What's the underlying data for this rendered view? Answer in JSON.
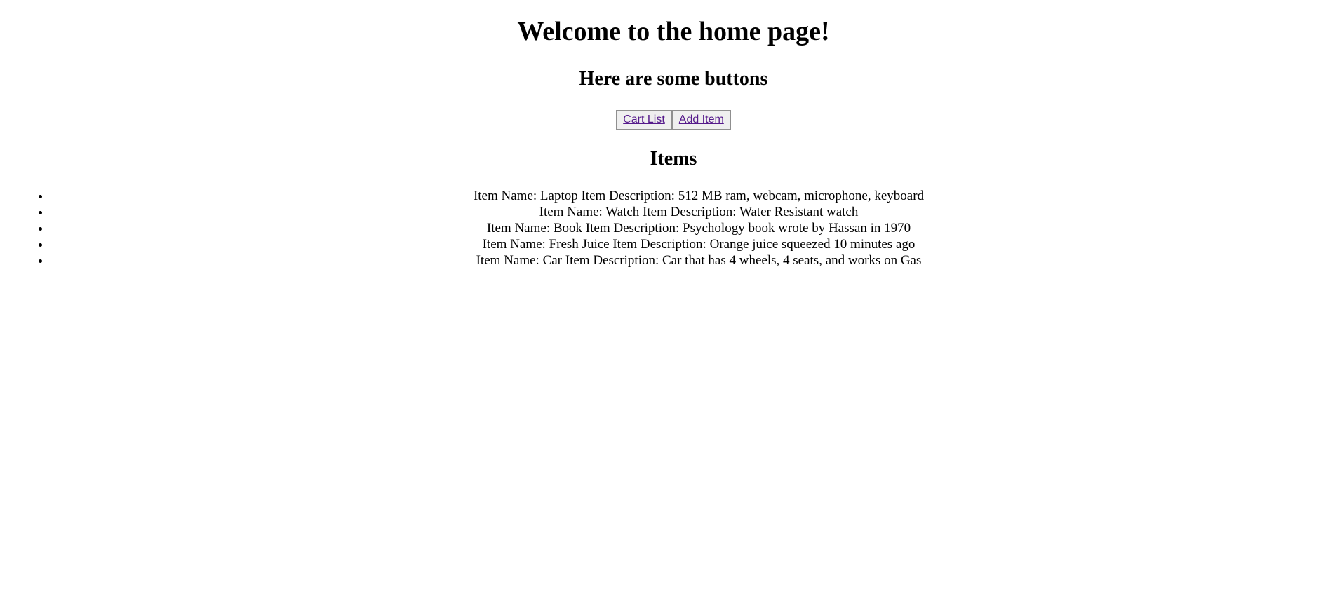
{
  "page": {
    "title": "Welcome to the home page!",
    "subtitle": "Here are some buttons",
    "items_heading": "Items"
  },
  "buttons": {
    "cart_list": "Cart List",
    "add_item": "Add Item"
  },
  "colors": {
    "link": "#551a8b",
    "button_bg": "#efefef",
    "button_border": "#8f8f8f"
  },
  "items": [
    {
      "text": "Item Name: Laptop Item Description: 512 MB ram, webcam, microphone, keyboard"
    },
    {
      "text": "Item Name: Watch Item Description: Water Resistant watch"
    },
    {
      "text": "Item Name: Book Item Description: Psychology book wrote by Hassan in 1970"
    },
    {
      "text": "Item Name: Fresh Juice Item Description: Orange juice squeezed 10 minutes ago"
    },
    {
      "text": "Item Name: Car Item Description: Car that has 4 wheels, 4 seats, and works on Gas"
    }
  ]
}
